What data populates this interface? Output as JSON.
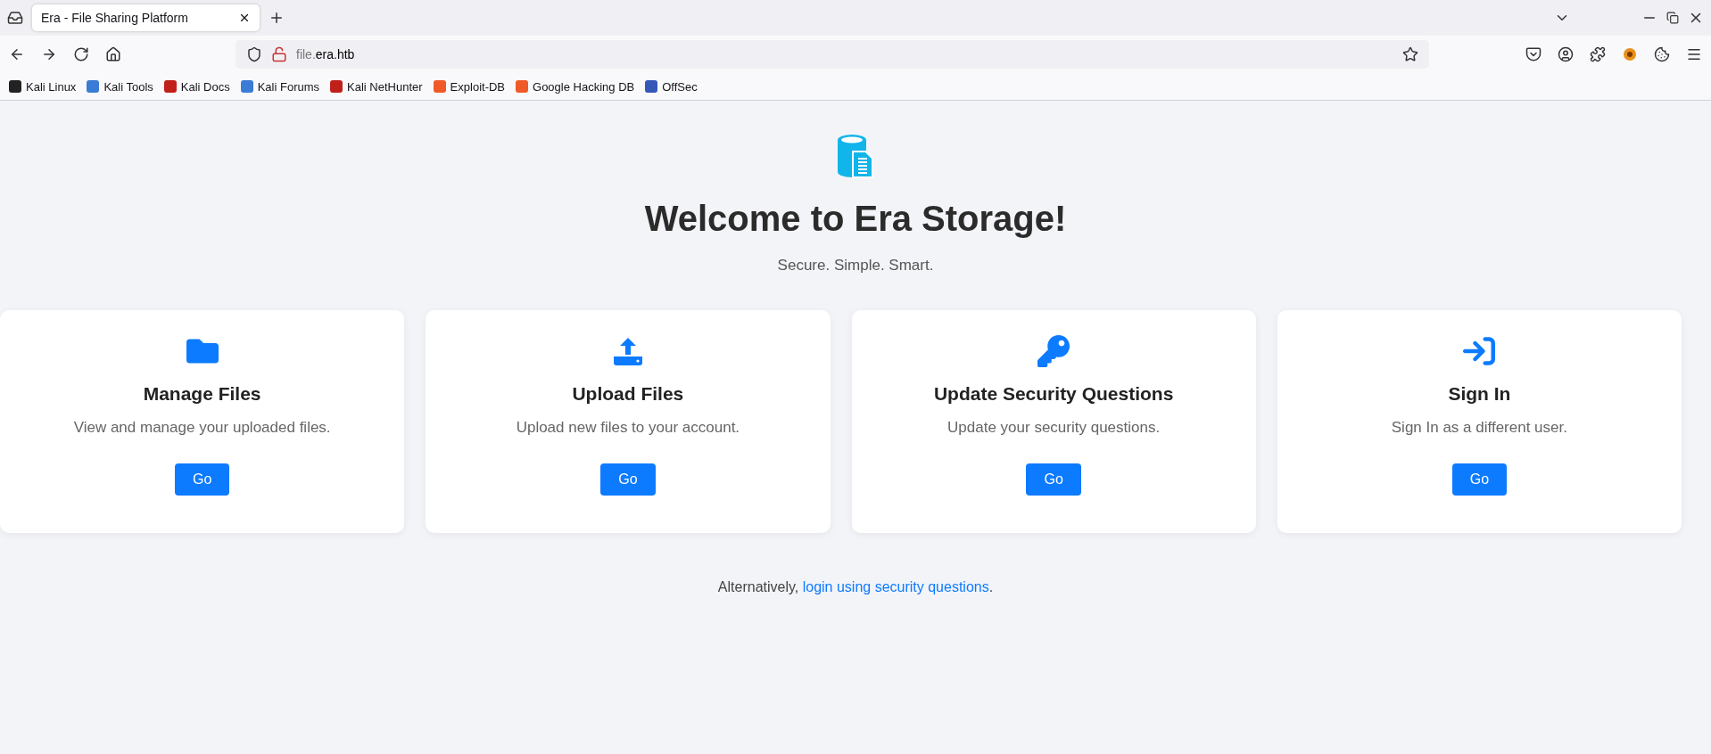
{
  "browser": {
    "tabs": [
      {
        "title": "Era - File Sharing Platform",
        "selected": true
      }
    ],
    "url": {
      "subdomain": "file.",
      "domain": "era.htb"
    },
    "bookmarks": [
      "Kali Linux",
      "Kali Tools",
      "Kali Docs",
      "Kali Forums",
      "Kali NetHunter",
      "Exploit-DB",
      "Google Hacking DB",
      "OffSec"
    ]
  },
  "page": {
    "heading": "Welcome to Era Storage!",
    "subtitle": "Secure. Simple. Smart.",
    "cards": [
      {
        "title": "Manage Files",
        "description": "View and manage your uploaded files.",
        "button": "Go"
      },
      {
        "title": "Upload Files",
        "description": "Upload new files to your account.",
        "button": "Go"
      },
      {
        "title": "Update Security Questions",
        "description": "Update your security questions.",
        "button": "Go"
      },
      {
        "title": "Sign In",
        "description": "Sign In as a different user.",
        "button": "Go"
      }
    ],
    "footer": {
      "text": "Alternatively, ",
      "link": "login using security questions",
      "end": "."
    }
  }
}
